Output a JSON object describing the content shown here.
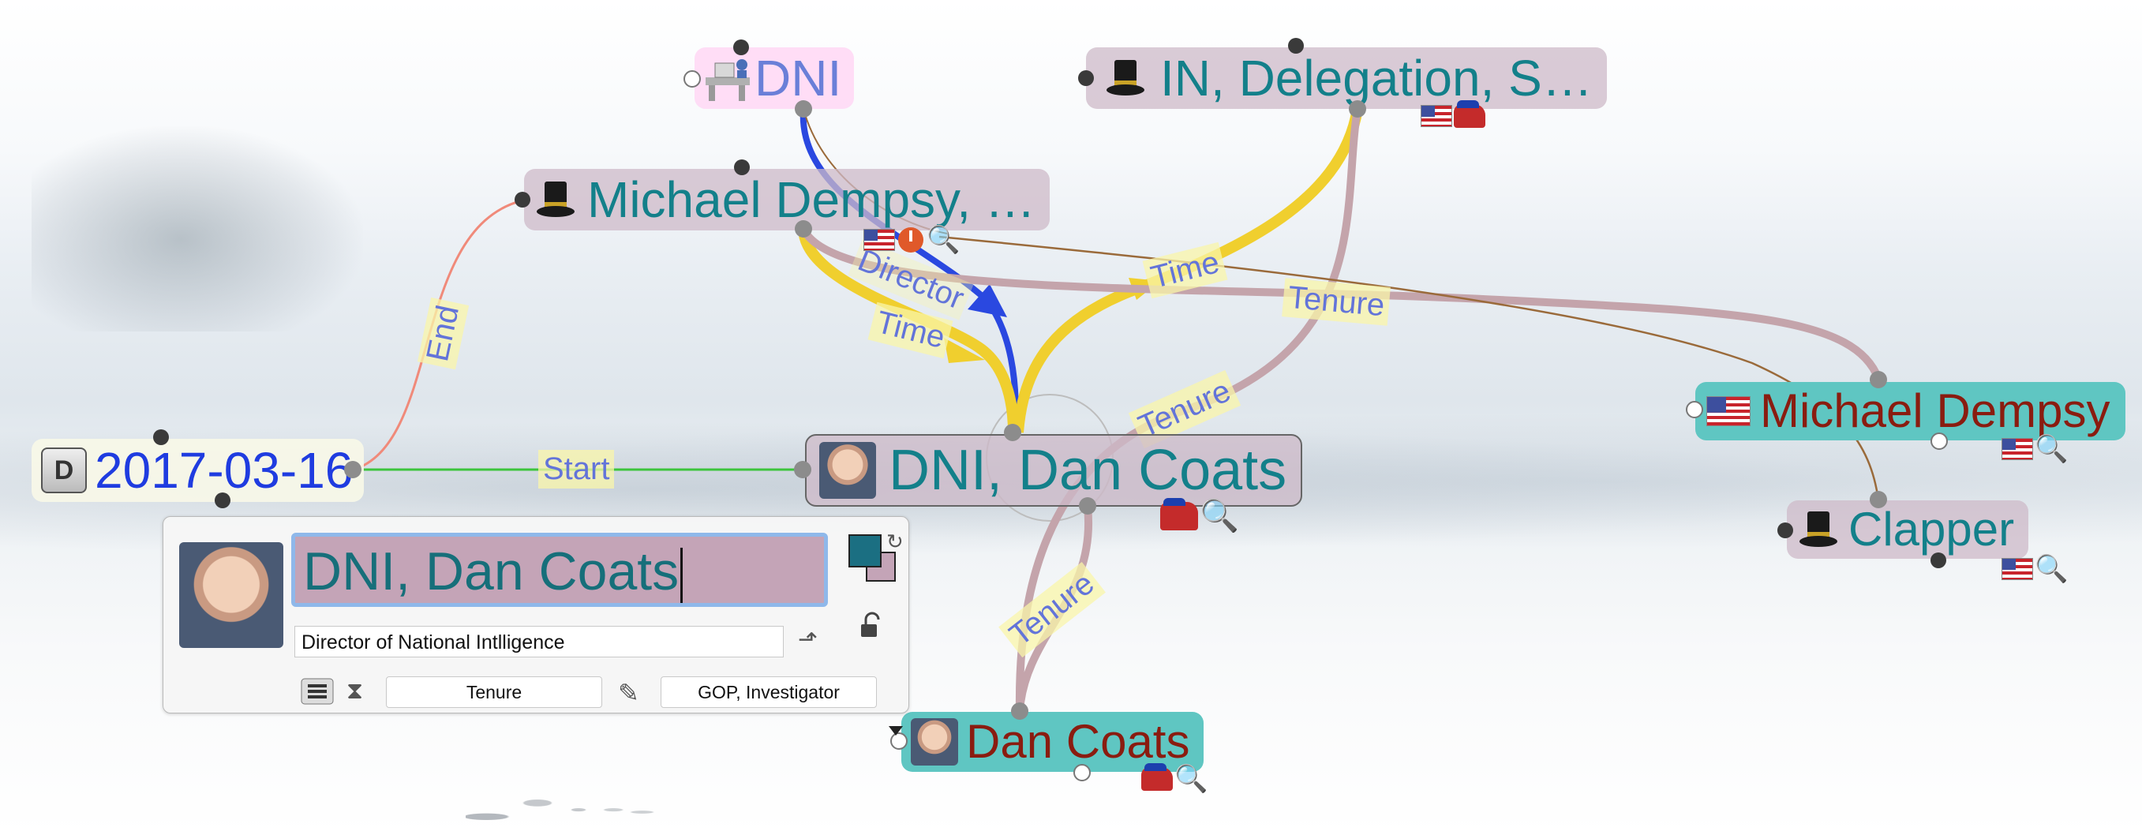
{
  "nodes": {
    "dni": {
      "label": "DNI",
      "icon": "desk-icon"
    },
    "delegation": {
      "label": "IN, Delegation, S…",
      "icon": "top-hat-icon"
    },
    "michael_dempsy_1": {
      "label": "Michael Dempsy, …",
      "icon": "top-hat-icon"
    },
    "date": {
      "label": "2017-03-16",
      "icon": "date-badge-icon",
      "icon_text": "D"
    },
    "dni_dan_coats": {
      "label": "DNI, Dan Coats",
      "icon": "portrait-icon"
    },
    "michael_dempsy_2": {
      "label": "Michael Dempsy",
      "icon": "us-flag-icon"
    },
    "clapper": {
      "label": "Clapper",
      "icon": "top-hat-icon"
    },
    "dan_coats": {
      "label": "Dan Coats",
      "icon": "portrait-icon"
    }
  },
  "edge_labels": {
    "end": "End",
    "start": "Start",
    "director": "Director",
    "time_1": "Time",
    "time_2": "Time",
    "tenure_1": "Tenure",
    "tenure_2": "Tenure",
    "tenure_3": "Tenure"
  },
  "editor": {
    "title_value": "DNI, Dan Coats",
    "subtitle_value": "Director of National Intlligence",
    "role_field": "Tenure",
    "tags_field": "GOP, Investigator",
    "fill_color": "#1b6f82",
    "stroke_color": "#c4a4b7"
  },
  "colors": {
    "teal_text": "#13808a",
    "blue_text": "#1f3ce0",
    "red_text": "#8a1c10",
    "time_link": "#f0cf2e",
    "director_link": "#2a48e0",
    "tenure_link": "#c4a4ab",
    "start_link": "#3cc43c",
    "end_link": "#f08a7a"
  }
}
